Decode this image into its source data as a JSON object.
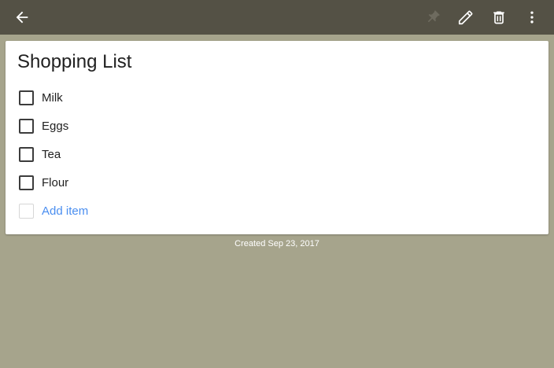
{
  "toolbar": {
    "back_icon": "arrow-left-icon",
    "pin_icon": "pin-icon",
    "edit_icon": "pencil-icon",
    "delete_icon": "trash-icon",
    "more_icon": "more-vertical-icon"
  },
  "note": {
    "title": "Shopping List",
    "items": [
      {
        "label": "Milk",
        "checked": false
      },
      {
        "label": "Eggs",
        "checked": false
      },
      {
        "label": "Tea",
        "checked": false
      },
      {
        "label": "Flour",
        "checked": false
      }
    ],
    "add_item_label": "Add item"
  },
  "footer": {
    "created": "Created Sep 23, 2017"
  },
  "colors": {
    "toolbar_bg": "#545145",
    "page_bg": "#a6a48c",
    "card_bg": "#ffffff",
    "add_item_text": "#4a8ef0"
  }
}
